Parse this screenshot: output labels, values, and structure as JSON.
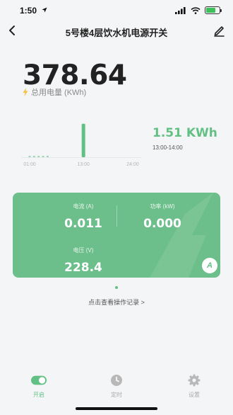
{
  "status": {
    "time": "1:50"
  },
  "header": {
    "title": "5号楼4层饮水机电源开关"
  },
  "total": {
    "value": "378.64",
    "label": "总用电量 (KWh)"
  },
  "chart_data": {
    "type": "bar",
    "x_ticks": [
      "01:00",
      "13:00",
      "24:00"
    ],
    "hours": [
      1,
      2,
      3,
      4,
      5,
      6,
      7,
      8,
      9,
      10,
      11,
      12,
      13,
      14,
      15,
      16,
      17,
      18,
      19,
      20,
      21,
      22,
      23,
      24
    ],
    "values": [
      0.01,
      0.01,
      0.01,
      0.01,
      0.01,
      0,
      0,
      0,
      0,
      0,
      0,
      0,
      1.51,
      0,
      0,
      0,
      0,
      0,
      0,
      0,
      0,
      0,
      0,
      0
    ],
    "ylim": [
      0,
      1.6
    ],
    "bar_color": "#62c084"
  },
  "reading": {
    "value": "1.51",
    "unit": "KWh",
    "range": "13:00-14:00"
  },
  "metrics": {
    "current": {
      "label": "电流 (A)",
      "value": "0.011"
    },
    "power": {
      "label": "功率 (kW)",
      "value": "0.000"
    },
    "voltage": {
      "label": "电压 (V)",
      "value": "228.4"
    },
    "mode": "A"
  },
  "log_link": "点击查看操作记录 >",
  "tabs": [
    {
      "label": "开启",
      "icon": "toggle-icon",
      "active": true
    },
    {
      "label": "定时",
      "icon": "clock-icon",
      "active": false
    },
    {
      "label": "设置",
      "icon": "gear-icon",
      "active": false
    }
  ],
  "colors": {
    "accent": "#62c084",
    "card": "#6cbf8a",
    "background": "#f4f5f7"
  }
}
